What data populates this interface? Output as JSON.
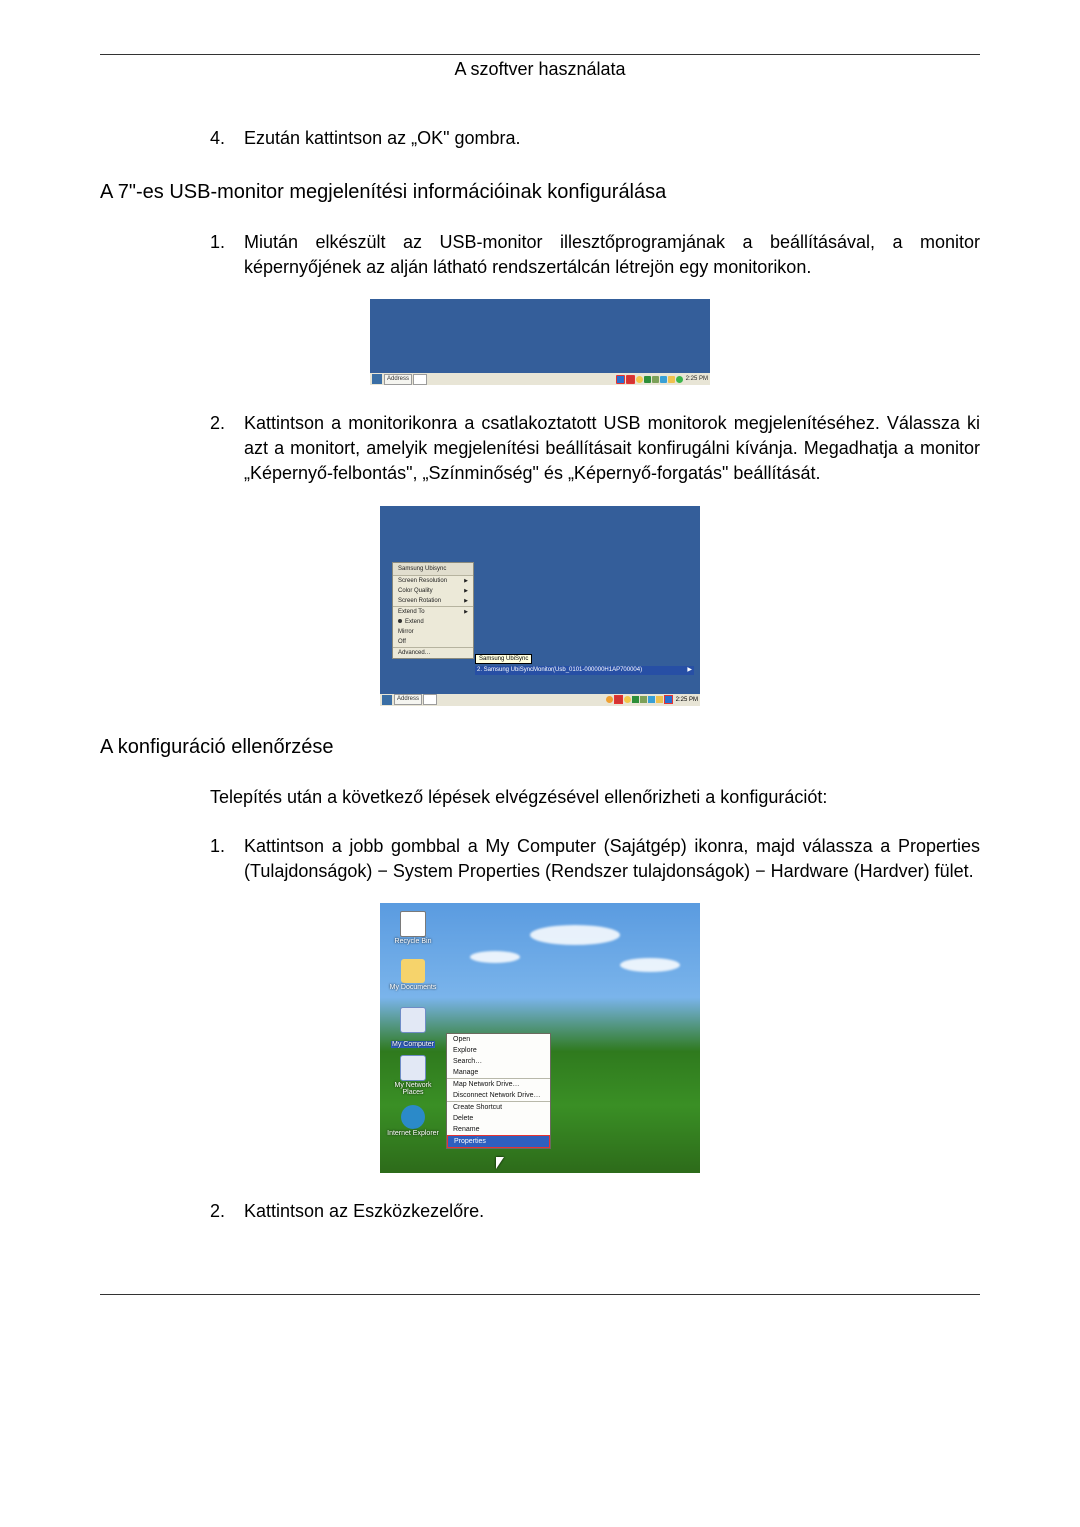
{
  "header": "A szoftver használata",
  "step4": {
    "num": "4.",
    "text": "Ezután kattintson az „OK\" gombra."
  },
  "sec1_title": "A 7\"-es USB-monitor megjelenítési információinak konfigurálása",
  "sec1": {
    "s1": {
      "num": "1.",
      "text": "Miután elkészült az USB-monitor illesztőprogramjának a beállításával, a monitor képernyőjének az alján látható rendszertálcán létrejön egy monitorikon."
    },
    "s2": {
      "num": "2.",
      "text": "Kattintson a monitorikonra a csatlakoztatott USB monitorok megjelenítéséhez. Válassza ki azt a monitort, amelyik megjelenítési beállításait konfirugálni kívánja. Megadhatja a monitor „Képernyő-felbontás\", „Színminőség\" és „Képernyő-forgatás\" beállítását."
    }
  },
  "img1": {
    "addr_label": "Address",
    "clock": "2:25 PM"
  },
  "img2": {
    "menu_title": "Samsung Ubisync",
    "m_res": "Screen Resolution",
    "m_color": "Color Quality",
    "m_rot": "Screen Rotation",
    "m_extto": "Extend To",
    "m_ext": "Extend",
    "m_mirror": "Mirror",
    "m_off": "Off",
    "m_adv": "Advanced…",
    "tooltip": "Samsung UbiSync",
    "hl": "2. Samsung UbiSyncMonitor(Usb_0101-000000H1AP700004)",
    "addr_label": "Address",
    "clock": "2:25 PM"
  },
  "sec2_title": "A konfiguráció ellenőrzése",
  "sec2_intro": "Telepítés után a következő lépések elvégzésével ellenőrizheti a konfigurációt:",
  "sec2": {
    "s1": {
      "num": "1.",
      "text": "Kattintson a jobb gombbal a My Computer (Sajátgép) ikonra, majd válassza a Properties (Tulajdonságok) − System Properties (Rendszer tulajdonságok) − Hardware (Hardver) fület."
    },
    "s2": {
      "num": "2.",
      "text": "Kattintson az Eszközkezelőre."
    }
  },
  "img3": {
    "icons": {
      "recycle": "Recycle Bin",
      "mydocs": "My Documents",
      "mycomp": "My Computer",
      "mynet": "My Network Places",
      "ie": "Internet Explorer"
    },
    "ctx": {
      "open": "Open",
      "explore": "Explore",
      "search": "Search…",
      "manage": "Manage",
      "mapnet": "Map Network Drive…",
      "discnet": "Disconnect Network Drive…",
      "shortcut": "Create Shortcut",
      "delete": "Delete",
      "rename": "Rename",
      "props": "Properties"
    }
  }
}
